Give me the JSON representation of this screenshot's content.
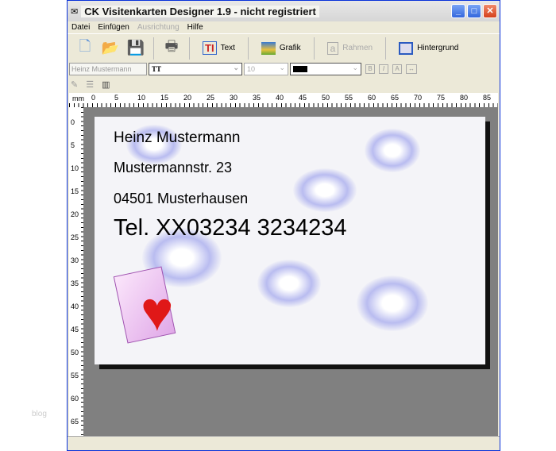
{
  "window": {
    "title": "CK Visitenkarten Designer 1.9 - nicht registriert"
  },
  "menu": [
    "Datei",
    "Einfügen",
    "Ausrichtung",
    "Hilfe"
  ],
  "toolbar": {
    "text": "Text",
    "grafik": "Grafik",
    "rahmen": "Rahmen",
    "hintergrund": "Hintergrund"
  },
  "format": {
    "text_value": "Heinz Mustermann",
    "font_icon": "TT",
    "size": "10",
    "bold": "B",
    "italic": "I"
  },
  "ruler": {
    "unit": "mm",
    "h_ticks": [
      "0",
      "5",
      "10",
      "15",
      "20",
      "25",
      "30",
      "35",
      "40",
      "45",
      "50",
      "55",
      "60",
      "65",
      "70",
      "75",
      "80",
      "85"
    ],
    "v_ticks": [
      "0",
      "5",
      "10",
      "15",
      "20",
      "25",
      "30",
      "35",
      "40",
      "45",
      "50",
      "55",
      "60",
      "65"
    ]
  },
  "card": {
    "line1": "Heinz Mustermann",
    "line2": "Mustermannstr. 23",
    "line3": "04501 Musterhausen",
    "line4": "Tel. XX03234 3234234"
  },
  "watermark": "blog"
}
